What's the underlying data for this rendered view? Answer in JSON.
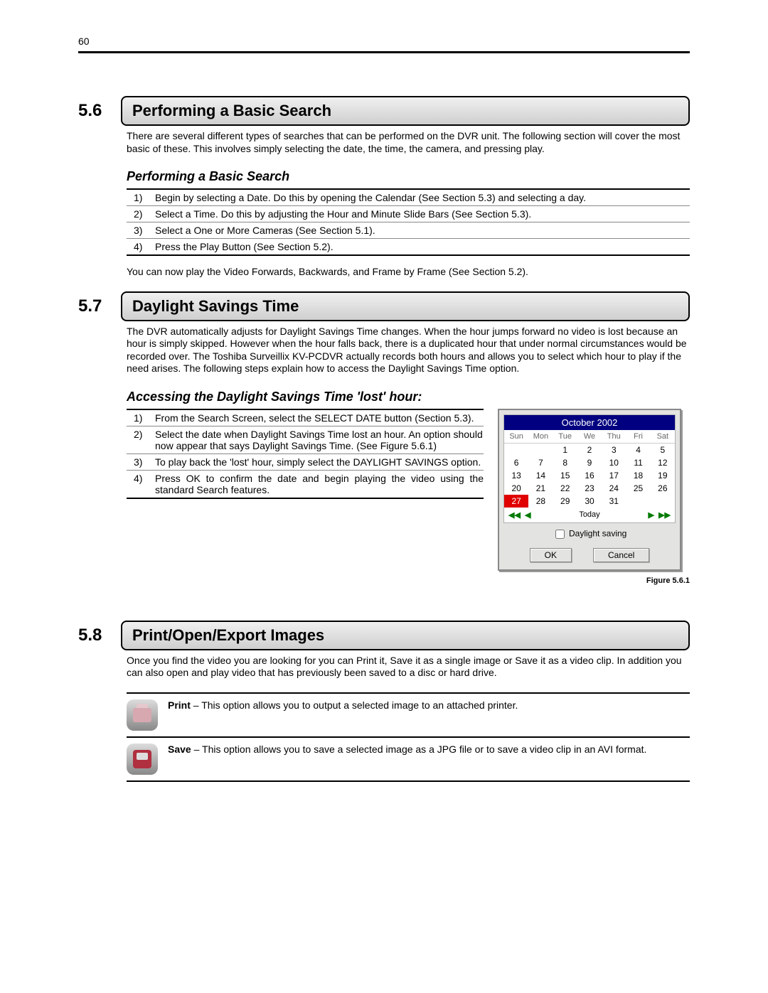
{
  "page_number": "60",
  "s56": {
    "num": "5.6",
    "title": "Performing a Basic Search",
    "intro": "There are several different types of searches that can be performed on the DVR unit. The following section will cover the most basic of these. This involves simply selecting the date, the time, the camera, and pressing play.",
    "subhead": "Performing a Basic Search",
    "steps": [
      {
        "n": "1)",
        "t": "Begin by selecting a Date. Do this by opening the Calendar (See Section 5.3) and selecting a day."
      },
      {
        "n": "2)",
        "t": "Select a Time. Do this by adjusting the Hour and Minute Slide Bars (See Section 5.3)."
      },
      {
        "n": "3)",
        "t": "Select a One or More Cameras (See Section 5.1)."
      },
      {
        "n": "4)",
        "t": "Press the Play Button (See Section 5.2)."
      }
    ],
    "after": "You can now play the Video Forwards, Backwards, and Frame by Frame (See Section 5.2)."
  },
  "s57": {
    "num": "5.7",
    "title": "Daylight Savings Time",
    "intro": "The DVR automatically adjusts for Daylight Savings Time changes. When the hour jumps forward no video is lost because an hour is simply skipped. However when the hour falls back, there is a duplicated hour that under normal circumstances would be recorded over. The Toshiba Surveillix KV-PCDVR actually records both hours and allows you to select which hour to play if the need arises. The following steps explain how to access the Daylight Savings Time option.",
    "subhead": "Accessing the Daylight Savings Time 'lost' hour:",
    "steps": [
      {
        "n": "1)",
        "t": "From the Search Screen, select the SELECT DATE button (Section 5.3)."
      },
      {
        "n": "2)",
        "t": "Select the date when Daylight Savings Time lost an hour. An option should now appear that says Daylight Savings Time. (See Figure 5.6.1)"
      },
      {
        "n": "3)",
        "t": "To play back the 'lost' hour, simply select the DAYLIGHT SAVINGS option."
      },
      {
        "n": "4)",
        "t": "Press OK to confirm the date and begin playing the video using the standard Search features."
      }
    ]
  },
  "calendar": {
    "title": "October 2002",
    "dow": [
      "Sun",
      "Mon",
      "Tue",
      "We",
      "Thu",
      "Fri",
      "Sat"
    ],
    "cells": [
      "",
      "",
      "1",
      "2",
      "3",
      "4",
      "5",
      "6",
      "7",
      "8",
      "9",
      "10",
      "11",
      "12",
      "13",
      "14",
      "15",
      "16",
      "17",
      "18",
      "19",
      "20",
      "21",
      "22",
      "23",
      "24",
      "25",
      "26",
      "27",
      "28",
      "29",
      "30",
      "31",
      "",
      ""
    ],
    "selected": "27",
    "today": "Today",
    "checkbox_label": "Daylight saving",
    "ok": "OK",
    "cancel": "Cancel",
    "figure": "Figure 5.6.1"
  },
  "s58": {
    "num": "5.8",
    "title": "Print/Open/Export Images",
    "intro": "Once you find the video you are looking for you can Print it, Save it as a single image or Save it as a video clip. In addition you can also open and play video that has previously been saved to a disc or hard drive.",
    "print_label": "Print",
    "print_text": " – This option allows you to output a selected image to an attached printer.",
    "save_label": "Save",
    "save_text": " – This option allows you to save a selected image as a JPG file or to save a video clip in an AVI format."
  }
}
